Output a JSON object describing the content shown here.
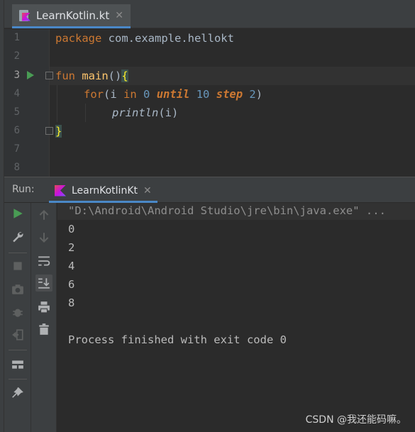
{
  "editor": {
    "tab_label": "LearnKotlin.kt",
    "tab_close": "✕",
    "line_numbers": [
      "1",
      "2",
      "3",
      "4",
      "5",
      "6",
      "7",
      "8"
    ],
    "code": {
      "line1_kw": "package",
      "line1_rest": " com.example.hellokt",
      "line3_kw": "fun",
      "line3_fn": "main",
      "line3_parens": "()",
      "line3_brace": "{",
      "line4_for": "for",
      "line4_open": "(i ",
      "line4_in": "in",
      "line4_zero": "0",
      "line4_until": "until",
      "line4_ten": "10",
      "line4_step": "step",
      "line4_two": "2",
      "line4_close": ")",
      "line5_println": "println",
      "line5_args": "(i)",
      "line6_brace": "}"
    }
  },
  "run_window": {
    "title": "Run:",
    "tab_label": "LearnKotlinKt",
    "tab_close": "✕"
  },
  "console": {
    "command": "\"D:\\Android\\Android Studio\\jre\\bin\\java.exe\" ...",
    "output": [
      "0",
      "2",
      "4",
      "6",
      "8"
    ],
    "finish_message": "Process finished with exit code 0"
  },
  "watermark": "CSDN @我还能码嘛。",
  "colors": {
    "keyword": "#cc7832",
    "function": "#ffc66d",
    "number": "#6897bb",
    "run_green": "#499c54",
    "accent_blue": "#4a88c7"
  }
}
